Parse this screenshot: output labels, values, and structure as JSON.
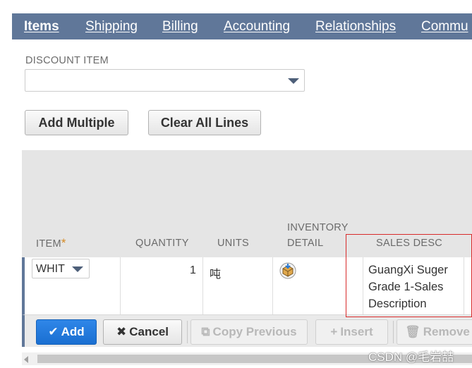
{
  "tabs": [
    {
      "label": "Items"
    },
    {
      "label": "Shipping"
    },
    {
      "label": "Billing"
    },
    {
      "label": "Accounting"
    },
    {
      "label": "Relationships"
    },
    {
      "label": "Commu"
    }
  ],
  "discount": {
    "label": "DISCOUNT ITEM",
    "value": ""
  },
  "buttons": {
    "add_multiple": "Add Multiple",
    "clear_all": "Clear All Lines"
  },
  "columns": {
    "item": "ITEM",
    "required_mark": "*",
    "quantity": "QUANTITY",
    "units": "UNITS",
    "inventory_line1": "INVENTORY",
    "inventory_line2": "DETAIL",
    "sales_desc": "SALES DESC"
  },
  "row": {
    "item": "WHIT",
    "quantity": "1",
    "units": "吨",
    "inventory_icon": "inventory-box-icon",
    "desc_lines": [
      "GuangXi Suger",
      "Grade 1-Sales",
      "Description"
    ]
  },
  "actions": {
    "add": "Add",
    "cancel": "Cancel",
    "copy_previous": "Copy Previous",
    "insert": "Insert",
    "remove": "Remove"
  },
  "watermark": "CSDN @毛岩喆",
  "colors": {
    "tab_bar": "#607799",
    "primary": "#1a6fd1",
    "highlight_box": "#d82b2b",
    "required": "#d68b24"
  }
}
